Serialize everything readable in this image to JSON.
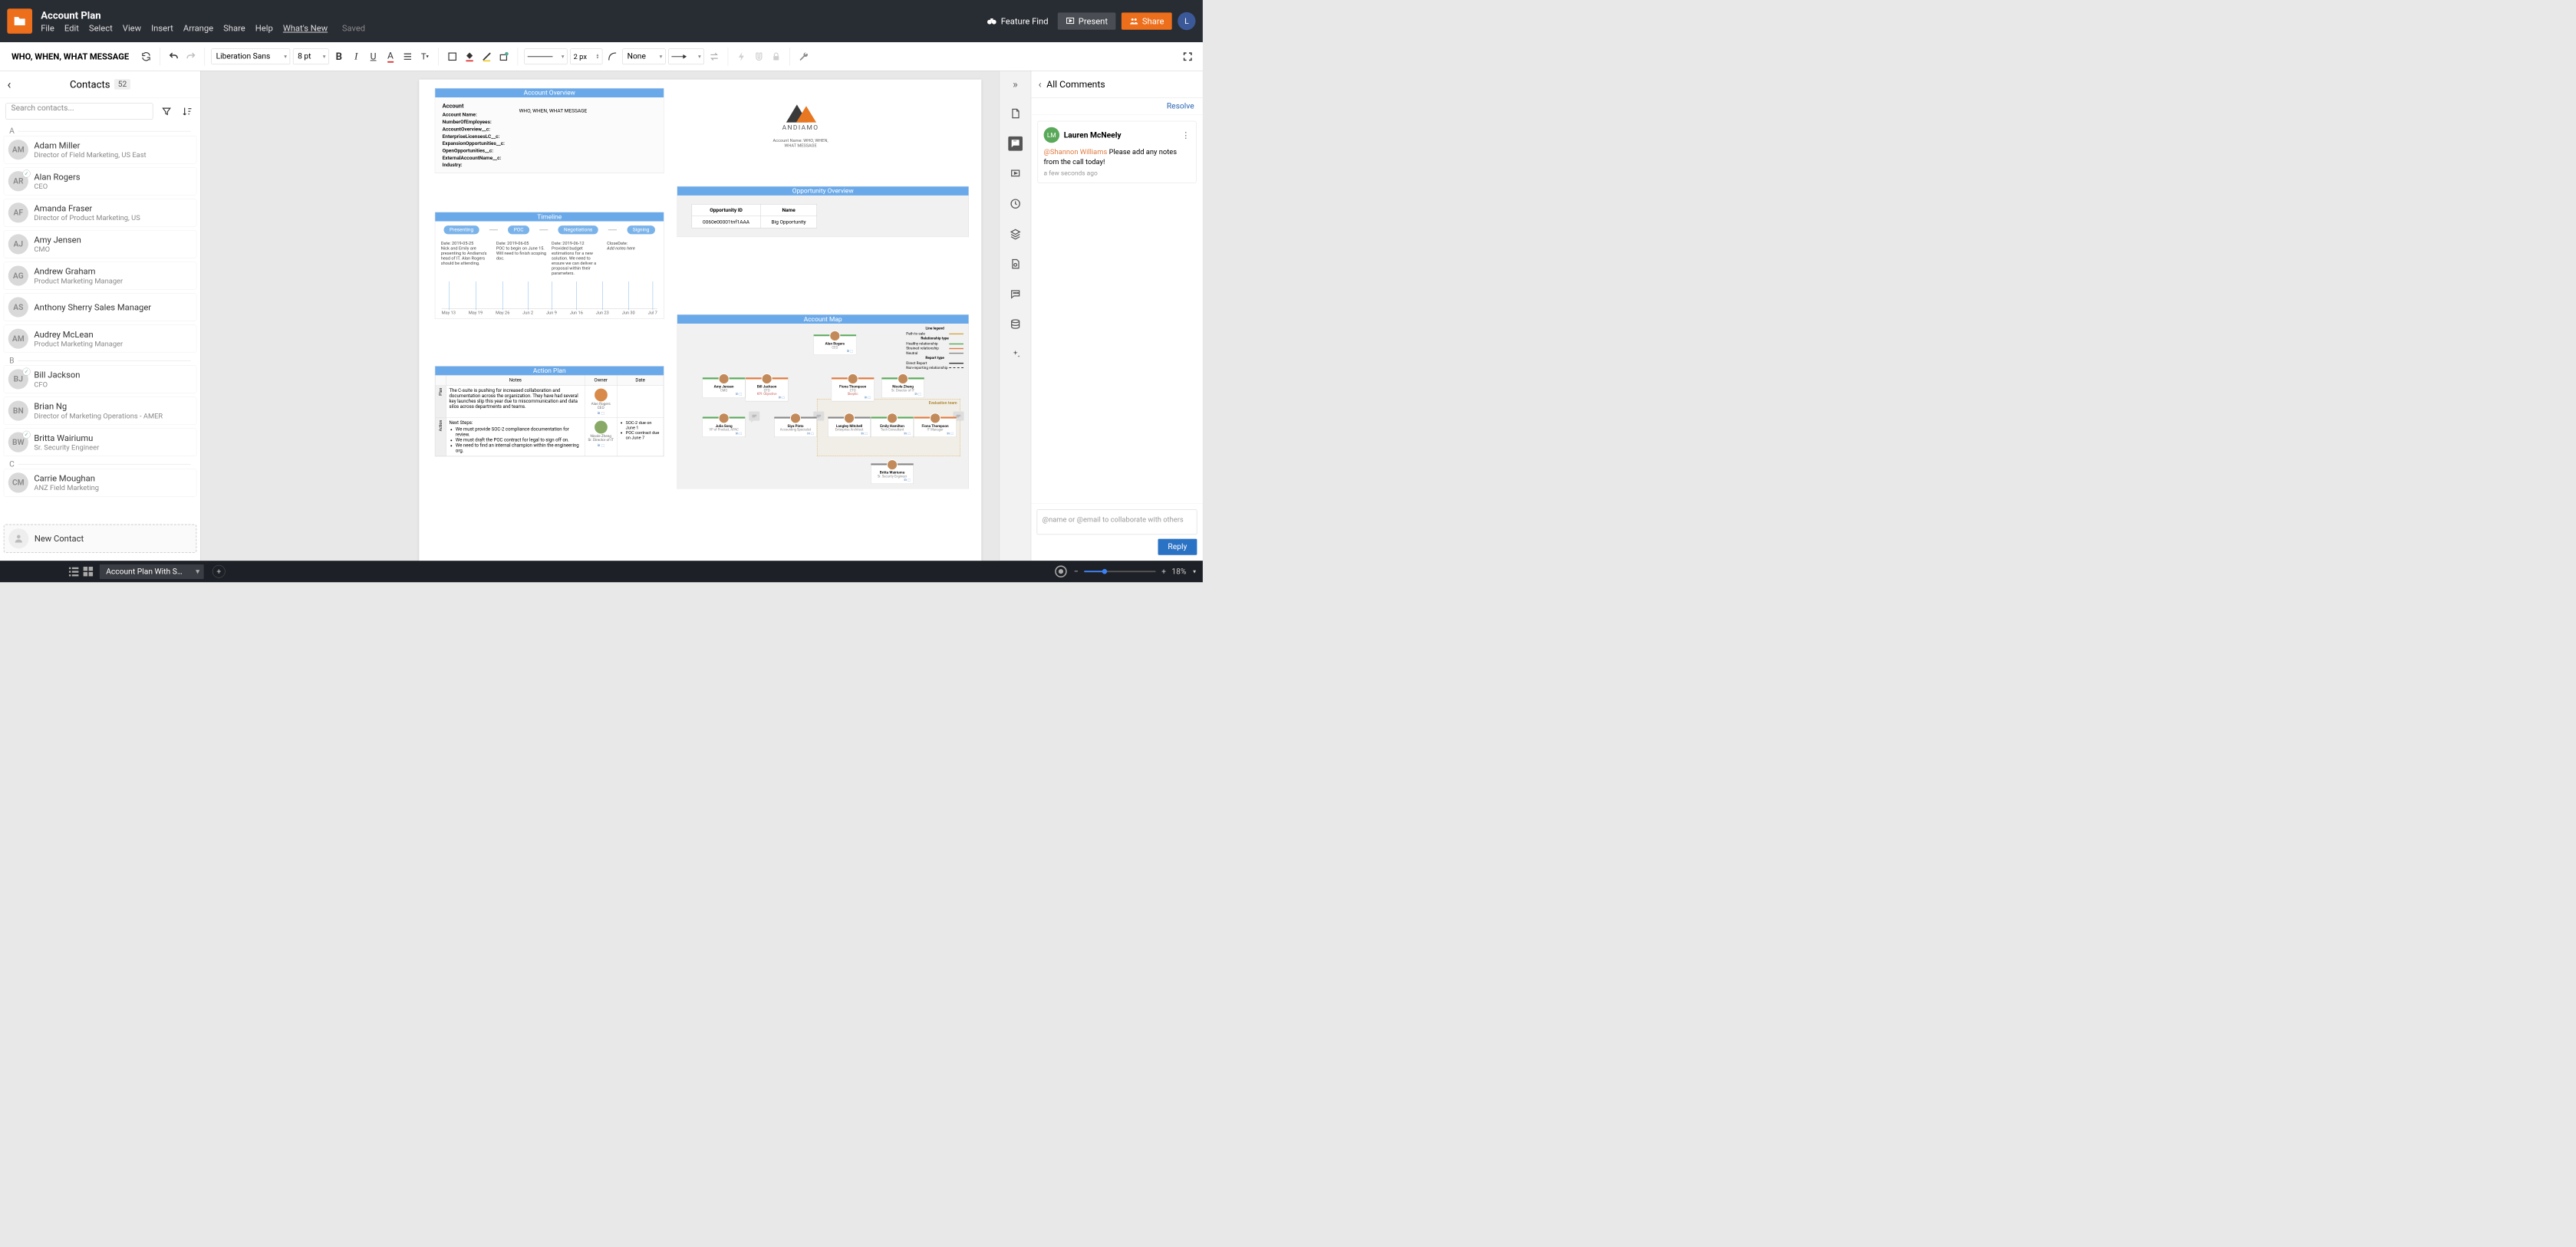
{
  "header": {
    "doc_title": "Account Plan",
    "menu": [
      "File",
      "Edit",
      "Select",
      "View",
      "Insert",
      "Arrange",
      "Share",
      "Help",
      "What's New"
    ],
    "saved": "Saved",
    "feature_find": "Feature Find",
    "present": "Present",
    "share": "Share",
    "avatar_initial": "L"
  },
  "toolbar": {
    "page_label": "WHO, WHEN, WHAT MESSAGE",
    "font": "Liberation Sans",
    "font_size": "8 pt",
    "stroke": "2 px",
    "arrow_start": "None"
  },
  "contacts": {
    "title": "Contacts",
    "count": "52",
    "search_placeholder": "Search contacts...",
    "new_contact": "New Contact",
    "groups": [
      {
        "letter": "A",
        "items": [
          {
            "initials": "AM",
            "name": "Adam Miller",
            "role": "Director of Field Marketing, US East",
            "checked": false
          },
          {
            "initials": "AR",
            "name": "Alan Rogers",
            "role": "CEO",
            "checked": true
          },
          {
            "initials": "AF",
            "name": "Amanda Fraser",
            "role": "Director of Product Marketing, US",
            "checked": false
          },
          {
            "initials": "AJ",
            "name": "Amy Jensen",
            "role": "CMO",
            "checked": false
          },
          {
            "initials": "AG",
            "name": "Andrew Graham",
            "role": "Product Marketing Manager",
            "checked": false
          },
          {
            "initials": "AS",
            "name": "Anthony Sherry Sales Manager",
            "role": "",
            "checked": false
          },
          {
            "initials": "AM",
            "name": "Audrey McLean",
            "role": "Product Marketing Manager",
            "checked": false
          }
        ]
      },
      {
        "letter": "B",
        "items": [
          {
            "initials": "BJ",
            "name": "Bill Jackson",
            "role": "CFO",
            "checked": true
          },
          {
            "initials": "BN",
            "name": "Brian Ng",
            "role": "Director of Marketing Operations - AMER",
            "checked": false
          },
          {
            "initials": "BW",
            "name": "Britta Wairiumu",
            "role": "Sr. Security Engineer",
            "checked": true
          }
        ]
      },
      {
        "letter": "C",
        "items": [
          {
            "initials": "CM",
            "name": "Carrie Moughan",
            "role": "ANZ Field Marketing",
            "checked": false
          }
        ]
      }
    ]
  },
  "page": {
    "account_overview": {
      "title": "Account Overview",
      "labels": [
        "Account",
        "Account Name:",
        "NumberOfEmployees:",
        "AccountOverview__c:",
        "EnterpriseLicensesLC__c:",
        "ExpansionOpportunities__c:",
        "OpenOpportunities__c:",
        "ExternalAccountName__c:",
        "Industry:"
      ],
      "account_name_value": "WHO, WHEN, WHAT MESSAGE"
    },
    "andiamo": {
      "name": "ANDIAMO",
      "sub_label": "Account Name:",
      "sub_value": "WHO, WHEN, WHAT MESSAGE"
    },
    "opportunity": {
      "title": "Opportunity Overview",
      "cols": [
        "Opportunity ID",
        "Name"
      ],
      "row": [
        "0060e00001tnf1AAA",
        "Big Opportunity"
      ]
    },
    "timeline": {
      "title": "Timeline",
      "stages": [
        "Presenting",
        "POC",
        "Negotiations",
        "Signing"
      ],
      "notes": [
        {
          "date": "Date: 2019-05-25",
          "text": "Nick and Emily are presenting to Andiamo's head of IT. Alan Rogers should be attending."
        },
        {
          "date": "Date: 2019-06-05",
          "text": "POC to begin on June 15. Will need to finish scoping doc."
        },
        {
          "date": "Date: 2019-06-12",
          "text": "Provided budget estimations for a new solution. We need to ensure we can deliver a proposal within their parameters."
        },
        {
          "date": "CloseDate:",
          "text": "Add notes here"
        }
      ],
      "ticks": [
        "May 13",
        "May 19",
        "May 26",
        "Jun 2",
        "Jun 9",
        "Jun 16",
        "Jun 23",
        "Jun 30",
        "Jul 7"
      ]
    },
    "action_plan": {
      "title": "Action Plan",
      "cols": [
        "Notes",
        "Owner",
        "Date"
      ],
      "rows": [
        {
          "side": "Plan",
          "notes": "The C-suite is pushing for increased collaboration and documentation across the organization. They have had several key launches slip this year due to miscommunication and data silos across departments and teams.",
          "owner_name": "Alan Rogers",
          "owner_role": "CEO",
          "date": ""
        },
        {
          "side": "Action",
          "notes_lead": "Next Steps:",
          "notes_items": [
            "We must provide SOC-2 compliance documentation for review.",
            "We must draft the POC contract for legal to sign off on.",
            "We need to find an internal champion within the engineering org."
          ],
          "owner_name": "Nicole Zheng",
          "owner_role": "Sr. Director of IT",
          "date_items": [
            "SOC-2 due on June 1",
            "POC contract due on June 7"
          ]
        }
      ]
    },
    "account_map": {
      "title": "Account Map",
      "legend": {
        "title": "Line legend",
        "path": "Path to sale",
        "rel_title": "Relationship type",
        "rels": [
          {
            "label": "Healthy relationship",
            "color": "#5aa95a"
          },
          {
            "label": "Strained relationship",
            "color": "#e07a3f"
          },
          {
            "label": "Neutral",
            "color": "#888"
          }
        ],
        "rep_title": "Report type",
        "reps": [
          {
            "label": "Direct Report",
            "style": "solid"
          },
          {
            "label": "Non-reporting relationship",
            "style": "dashed"
          }
        ]
      },
      "eval_label": "Evaluation team",
      "cards": [
        {
          "name": "Alan Rogers",
          "role": "CEO",
          "rel": "healthy"
        },
        {
          "name": "Amy Jensen",
          "role": "CMO",
          "rel": "healthy"
        },
        {
          "name": "Bill Jackson",
          "role": "CFO",
          "rel": "strained",
          "note": "KPI: Objective"
        },
        {
          "name": "Fiona Thompson",
          "role": "CTO",
          "rel": "strained",
          "note": "Skeptic"
        },
        {
          "name": "Nicole Zheng",
          "role": "Sr. Director of IT",
          "rel": "healthy"
        },
        {
          "name": "Julia Song",
          "role": "VP of Product, APAC",
          "rel": "healthy"
        },
        {
          "name": "Siya Pinto",
          "role": "Accounting Specialist",
          "rel": "neutral"
        },
        {
          "name": "Langley Mitchell",
          "role": "Enterprise Architect",
          "rel": "neutral"
        },
        {
          "name": "Emily Hamilton",
          "role": "Tech Consultant",
          "rel": "healthy"
        },
        {
          "name": "Fiona Thompson",
          "role": "IT Manager",
          "rel": "strained"
        },
        {
          "name": "Britta Wairiumu",
          "role": "Sr. Security Engineer",
          "rel": "neutral"
        }
      ]
    }
  },
  "comments": {
    "title": "All Comments",
    "resolve": "Resolve",
    "items": [
      {
        "initials": "LM",
        "name": "Lauren McNeely",
        "mention": "@Shannon Williams",
        "text": "Please add any notes from the call today!",
        "time": "a few seconds ago"
      }
    ],
    "reply_placeholder": "@name or @email to collaborate with others",
    "reply_button": "Reply"
  },
  "footer": {
    "doc_tab": "Account Plan With S…",
    "zoom": "18%"
  }
}
